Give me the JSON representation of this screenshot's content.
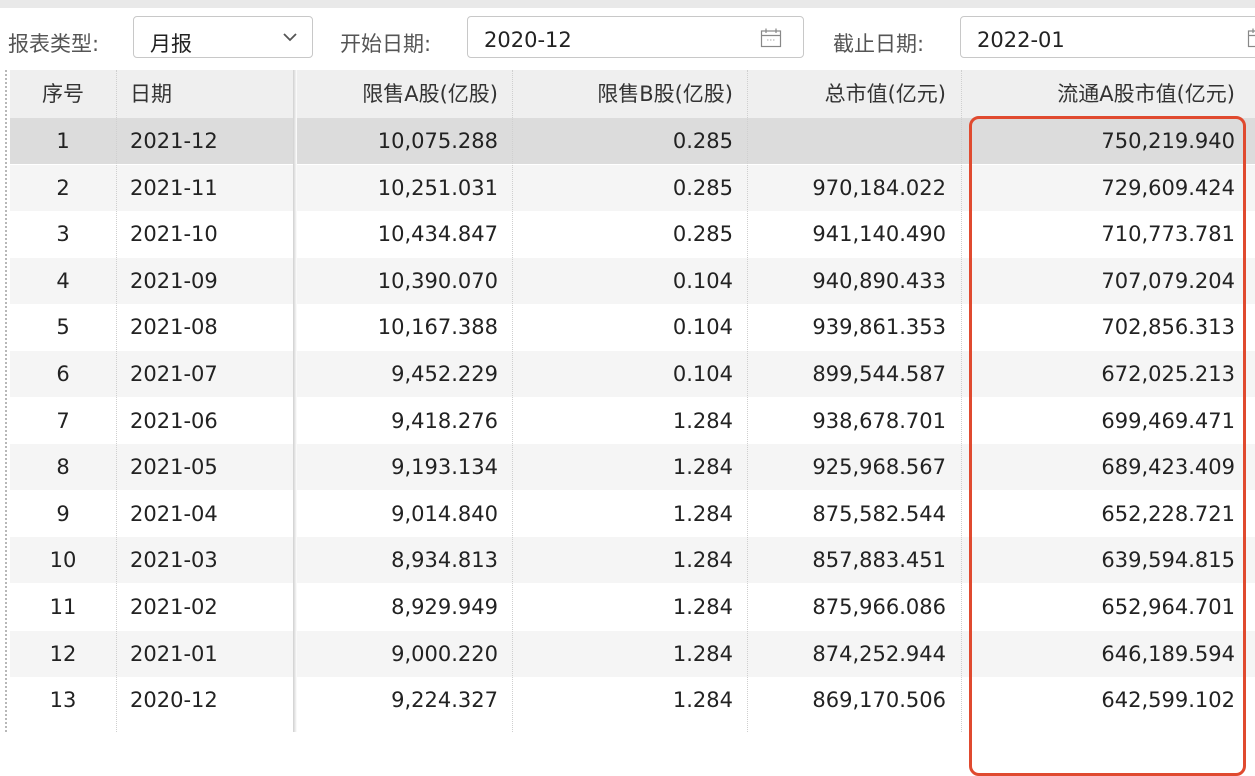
{
  "toolbar": {
    "report_type_label": "报表类型:",
    "report_type_value": "月报",
    "start_date_label": "开始日期:",
    "start_date_value": "2020-12",
    "end_date_label": "截止日期:",
    "end_date_value": "2022-01"
  },
  "table": {
    "headers": {
      "seq": "序号",
      "date": "日期",
      "restricted_a": "限售A股(亿股)",
      "restricted_b": "限售B股(亿股)",
      "total_mv": "总市值(亿元)",
      "float_a_mv": "流通A股市值(亿元)"
    },
    "rows": [
      {
        "seq": "1",
        "date": "2021-12",
        "a": "10,075.288",
        "b": "0.285",
        "tot": "",
        "flow": "750,219.940"
      },
      {
        "seq": "2",
        "date": "2021-11",
        "a": "10,251.031",
        "b": "0.285",
        "tot": "970,184.022",
        "flow": "729,609.424"
      },
      {
        "seq": "3",
        "date": "2021-10",
        "a": "10,434.847",
        "b": "0.285",
        "tot": "941,140.490",
        "flow": "710,773.781"
      },
      {
        "seq": "4",
        "date": "2021-09",
        "a": "10,390.070",
        "b": "0.104",
        "tot": "940,890.433",
        "flow": "707,079.204"
      },
      {
        "seq": "5",
        "date": "2021-08",
        "a": "10,167.388",
        "b": "0.104",
        "tot": "939,861.353",
        "flow": "702,856.313"
      },
      {
        "seq": "6",
        "date": "2021-07",
        "a": "9,452.229",
        "b": "0.104",
        "tot": "899,544.587",
        "flow": "672,025.213"
      },
      {
        "seq": "7",
        "date": "2021-06",
        "a": "9,418.276",
        "b": "1.284",
        "tot": "938,678.701",
        "flow": "699,469.471"
      },
      {
        "seq": "8",
        "date": "2021-05",
        "a": "9,193.134",
        "b": "1.284",
        "tot": "925,968.567",
        "flow": "689,423.409"
      },
      {
        "seq": "9",
        "date": "2021-04",
        "a": "9,014.840",
        "b": "1.284",
        "tot": "875,582.544",
        "flow": "652,228.721"
      },
      {
        "seq": "10",
        "date": "2021-03",
        "a": "8,934.813",
        "b": "1.284",
        "tot": "857,883.451",
        "flow": "639,594.815"
      },
      {
        "seq": "11",
        "date": "2021-02",
        "a": "8,929.949",
        "b": "1.284",
        "tot": "875,966.086",
        "flow": "652,964.701"
      },
      {
        "seq": "12",
        "date": "2021-01",
        "a": "9,000.220",
        "b": "1.284",
        "tot": "874,252.944",
        "flow": "646,189.594"
      },
      {
        "seq": "13",
        "date": "2020-12",
        "a": "9,224.327",
        "b": "1.284",
        "tot": "869,170.506",
        "flow": "642,599.102"
      }
    ]
  },
  "colors": {
    "highlight": "#e04a2f",
    "selected_row": "#dcdcdc",
    "zebra_row": "#f5f5f5"
  }
}
